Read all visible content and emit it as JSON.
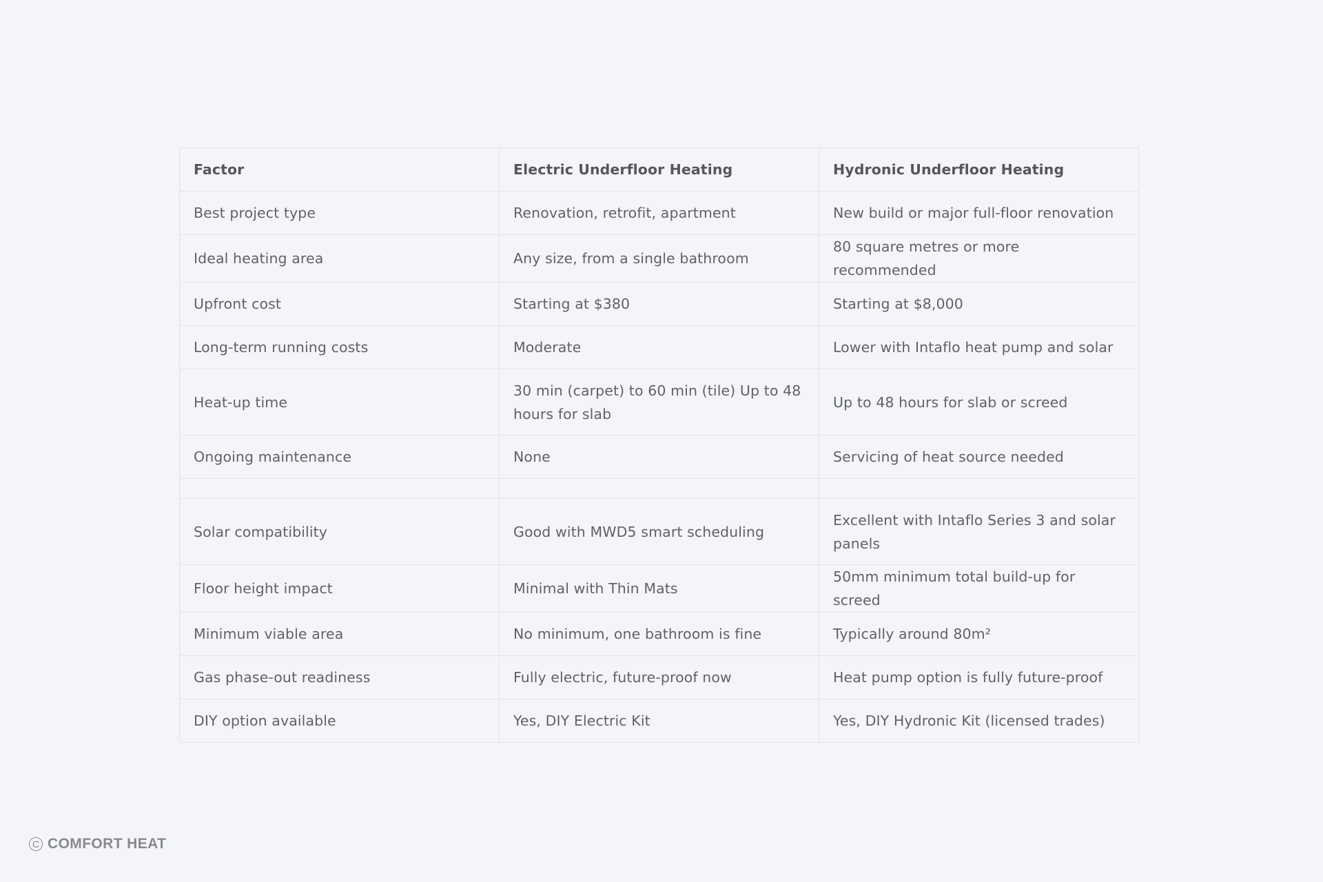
{
  "table": {
    "headers": [
      "Factor",
      "Electric Underfloor Heating",
      "Hydronic Underfloor Heating"
    ],
    "rows": [
      [
        "Best project type",
        "Renovation, retrofit, apartment",
        "New build or major full-floor renovation"
      ],
      [
        "Ideal heating area",
        "Any size, from a single bathroom",
        "80 square metres or more recommended"
      ],
      [
        "Upfront cost",
        "Starting at $380",
        "Starting at $8,000"
      ],
      [
        "Long-term running costs",
        "Moderate",
        "Lower with Intaflo heat pump and solar"
      ],
      [
        "Heat-up time",
        "30 min (carpet) to 60 min (tile) Up to 48 hours for slab",
        "Up to 48 hours for slab or screed"
      ],
      [
        "Ongoing maintenance",
        "None",
        "Servicing of heat source needed"
      ],
      [
        "",
        "",
        ""
      ],
      [
        "Solar compatibility",
        "Good with MWD5 smart scheduling",
        "Excellent with Intaflo Series 3 and solar panels"
      ],
      [
        "Floor height impact",
        "Minimal with Thin Mats",
        "50mm minimum total build-up for screed"
      ],
      [
        "Minimum viable area",
        "No minimum, one bathroom is fine",
        "Typically around 80m²"
      ],
      [
        "Gas phase-out readiness",
        "Fully electric, future-proof now",
        "Heat pump option is fully future-proof"
      ],
      [
        "DIY option available",
        "Yes, DIY Electric Kit",
        "Yes, DIY Hydronic Kit (licensed trades)"
      ]
    ]
  },
  "footer": {
    "logo_mark": "C",
    "brand": "COMFORT HEAT"
  }
}
